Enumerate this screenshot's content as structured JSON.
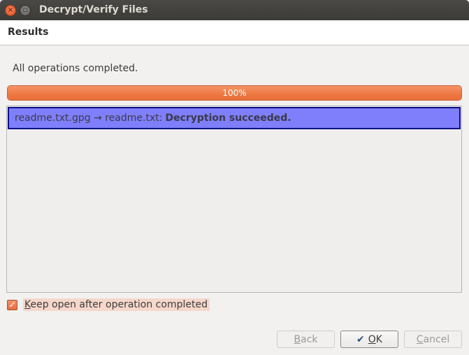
{
  "window": {
    "title": "Decrypt/Verify Files",
    "close_glyph": "×",
    "minimize_glyph": "▫"
  },
  "header": {
    "title": "Results"
  },
  "status": {
    "text": "All operations completed."
  },
  "progress": {
    "percent": 100,
    "label": "100%"
  },
  "results": [
    {
      "file_chain": "readme.txt.gpg → readme.txt:",
      "message": "Decryption succeeded."
    }
  ],
  "keep_open": {
    "checked": true,
    "mnemonic": "K",
    "label_rest": "eep open after operation completed"
  },
  "buttons": {
    "back": {
      "mnemonic": "B",
      "rest": "ack",
      "enabled": false
    },
    "ok": {
      "mnemonic": "O",
      "rest": "K",
      "icon": "checkmark-icon",
      "enabled": true
    },
    "cancel": {
      "mnemonic": "C",
      "rest": "ancel",
      "enabled": false
    }
  },
  "colors": {
    "accent": "#ee7a45",
    "selection": "#7f7ffb",
    "selection_border": "#0d0f86"
  }
}
